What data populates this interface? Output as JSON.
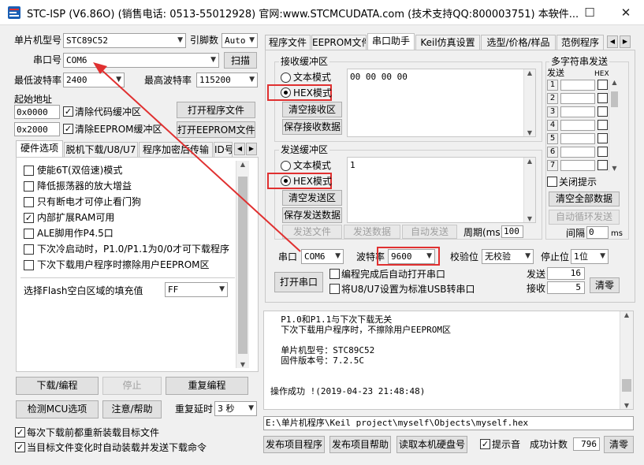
{
  "window": {
    "title": "STC-ISP (V6.86O) (销售电话: 0513-55012928) 官网:www.STCMCUDATA.com  (技术支持QQ:800003751) 本软件...",
    "minimize": "—",
    "maximize": "☐",
    "close": "✕"
  },
  "left": {
    "mcu_type_label": "单片机型号",
    "mcu_type_value": "STC89C52",
    "pins_label": "引脚数",
    "pins_value": "Auto",
    "port_label": "串口号",
    "port_value": "COM6",
    "scan_button": "扫描",
    "min_baud_label": "最低波特率",
    "min_baud_value": "2400",
    "max_baud_label": "最高波特率",
    "max_baud_value": "115200",
    "start_addr_label": "起始地址",
    "addr1": "0x0000",
    "addr2": "0x2000",
    "clear_code_label": "清除代码缓冲区",
    "clear_eeprom_label": "清除EEPROM缓冲区",
    "open_prog_button": "打开程序文件",
    "open_eeprom_button": "打开EEPROM文件",
    "tabs": [
      "硬件选项",
      "脱机下载/U8/U7",
      "程序加密后传输",
      "ID号"
    ],
    "options": [
      {
        "label": "使能6T(双倍速)模式",
        "checked": false
      },
      {
        "label": "降低振荡器的放大增益",
        "checked": false
      },
      {
        "label": "只有断电才可停止看门狗",
        "checked": false
      },
      {
        "label": "内部扩展RAM可用",
        "checked": true
      },
      {
        "label": "ALE脚用作P4.5口",
        "checked": false
      },
      {
        "label": "下次冷启动时，P1.0/P1.1为0/0才可下载程序",
        "checked": false
      },
      {
        "label": "下次下载用户程序时擦除用户EEPROM区",
        "checked": false
      }
    ],
    "flash_fill_label": "选择Flash空白区域的填充值",
    "flash_fill_value": "FF",
    "download_button": "下载/编程",
    "stop_button": "停止",
    "reprogram_button": "重复编程",
    "check_mcu_button": "检测MCU选项",
    "help_button": "注意/帮助",
    "delay_label": "重复延时",
    "delay_value": "3 秒",
    "reload_label": "每次下载前都重新装载目标文件",
    "auto_label": "当目标文件变化时自动装载并发送下载命令"
  },
  "right": {
    "tabs": [
      "程序文件",
      "EEPROM文件",
      "串口助手",
      "Keil仿真设置",
      "选型/价格/样品",
      "范例程序"
    ],
    "recv_group": "接收缓冲区",
    "text_mode": "文本模式",
    "hex_mode": "HEX模式",
    "clear_recv": "清空接收区",
    "save_recv": "保存接收数据",
    "recv_data": "00 00 00 00",
    "send_group": "发送缓冲区",
    "clear_send": "清空发送区",
    "save_send": "保存发送数据",
    "send_data": "1",
    "send_file": "发送文件",
    "send_data_btn": "发送数据",
    "auto_send": "自动发送",
    "period_label": "周期(ms)",
    "period_value": "100",
    "multi_title": "多字符串发送",
    "send_col": "发送",
    "hex_col": "HEX",
    "row_numbers": [
      "1",
      "2",
      "3",
      "4",
      "5",
      "6",
      "7"
    ],
    "close_hint": "关闭提示",
    "clear_all": "清空全部数据",
    "auto_cycle": "自动循环发送",
    "interval_label": "间隔",
    "interval_value": "0",
    "interval_unit": "ms",
    "port_label": "串口",
    "port_value": "COM6",
    "baud_label": "波特率",
    "baud_value": "9600",
    "parity_label": "校验位",
    "parity_value": "无校验",
    "stop_label": "停止位",
    "stop_value": "1位",
    "open_port": "打开串口",
    "auto_open_label": "编程完成后自动打开串口",
    "usb_label": "将U8/U7设置为标准USB转串口",
    "sent_label": "发送",
    "sent_value": "16",
    "recv_label": "接收",
    "recv_value": "5",
    "clear_counts": "清零",
    "log_lines": [
      "  P1.0和P1.1与下次下载无关",
      "  下次下载用户程序时，不擦除用户EEPROM区",
      "",
      "  单片机型号：STC89C52",
      "  固件版本号：7.2.5C",
      "",
      "",
      "操作成功 !(2019-04-23 21:48:48)"
    ],
    "file_path": "E:\\单片机程序\\Keil project\\myself\\Objects\\myself.hex",
    "publish_prog": "发布项目程序",
    "publish_help": "发布项目帮助",
    "read_disk": "读取本机硬盘号",
    "beep_label": "提示音",
    "success_label": "成功计数",
    "success_value": "796",
    "clear_button": "清零"
  },
  "colors": {
    "red": "#e03030",
    "accent": "#0b65c2"
  }
}
